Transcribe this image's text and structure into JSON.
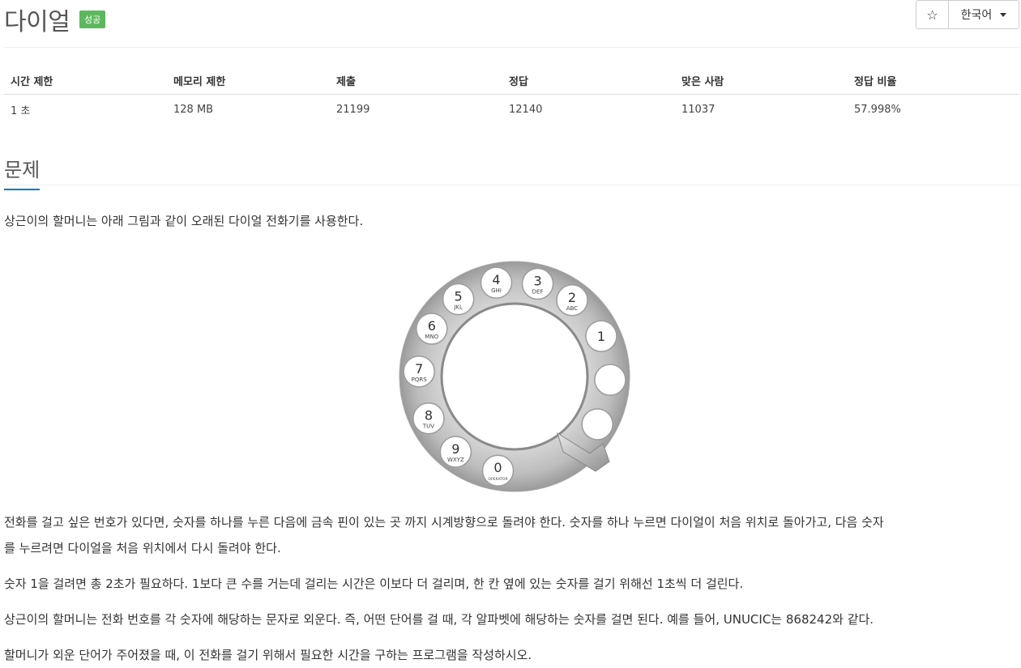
{
  "header": {
    "title": "다이얼",
    "badge": "성공",
    "star_icon": "star-icon",
    "star_glyph": "☆",
    "language": "한국어"
  },
  "stats": {
    "headers": [
      "시간 제한",
      "메모리 제한",
      "제출",
      "정답",
      "맞은 사람",
      "정답 비율"
    ],
    "values": [
      "1 초",
      "128 MB",
      "21199",
      "12140",
      "11037",
      "57.998%"
    ]
  },
  "section": {
    "title": "문제"
  },
  "problem": {
    "p1": "상근이의 할머니는 아래 그림과 같이 오래된 다이얼 전화기를 사용한다.",
    "p2a": "전화를 걸고 싶은 번호가 있다면, 숫자를 하나를 누른 다음에 금속 핀이 있는 곳 까지 시계방향으로 돌려야 한다. 숫자를 하나 누르면 다이얼이 처음 위치로 돌아가고, 다음 숫자",
    "p2b": "를 누르려면 다이얼을 처음 위치에서 다시 돌려야 한다.",
    "p3": "숫자 1을 걸려면 총 2초가 필요하다. 1보다 큰 수를 거는데 걸리는 시간은 이보다 더 걸리며, 한 칸 옆에 있는 숫자를 걸기 위해선 1초씩 더 걸린다.",
    "p4": "상근이의 할머니는 전화 번호를 각 숫자에 해당하는 문자로 외운다. 즉, 어떤 단어를 걸 때, 각 알파벳에 해당하는 숫자를 걸면 된다. 예를 들어, UNUCIC는 868242와 같다.",
    "p5": "할머니가 외운 단어가 주어졌을 때, 이 전화를 걸기 위해서 필요한 시간을 구하는 프로그램을 작성하시오."
  },
  "dial": {
    "holes": [
      {
        "num": "1",
        "letters": ""
      },
      {
        "num": "2",
        "letters": "ABC"
      },
      {
        "num": "3",
        "letters": "DEF"
      },
      {
        "num": "4",
        "letters": "GHI"
      },
      {
        "num": "5",
        "letters": "JKL"
      },
      {
        "num": "6",
        "letters": "MNO"
      },
      {
        "num": "7",
        "letters": "PQRS"
      },
      {
        "num": "8",
        "letters": "TUV"
      },
      {
        "num": "9",
        "letters": "WXYZ"
      },
      {
        "num": "0",
        "letters": "OPERATOR"
      },
      {
        "num": "",
        "letters": ""
      },
      {
        "num": "",
        "letters": ""
      }
    ]
  }
}
